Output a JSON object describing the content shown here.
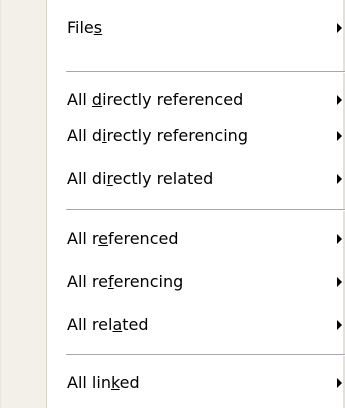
{
  "menu": {
    "items": [
      {
        "label": "Files",
        "mnemonic_index": 4,
        "submenu": true
      },
      {
        "label": "All directly referenced",
        "mnemonic_index": 4,
        "submenu": true
      },
      {
        "label": "All directly referencing",
        "mnemonic_index": 5,
        "submenu": true
      },
      {
        "label": "All directly related",
        "mnemonic_index": 6,
        "submenu": true
      },
      {
        "label": "All referenced",
        "mnemonic_index": 5,
        "submenu": true
      },
      {
        "label": "All referencing",
        "mnemonic_index": 6,
        "submenu": true
      },
      {
        "label": "All related",
        "mnemonic_index": 7,
        "submenu": true
      },
      {
        "label": "All linked",
        "mnemonic_index": 7,
        "submenu": true
      }
    ]
  },
  "icons": {
    "submenu_arrow": "chevron-right-icon"
  },
  "colors": {
    "gutter": "#f2f0e9",
    "background": "#ffffff",
    "separator": "#a7a6aa",
    "text": "#000000"
  }
}
